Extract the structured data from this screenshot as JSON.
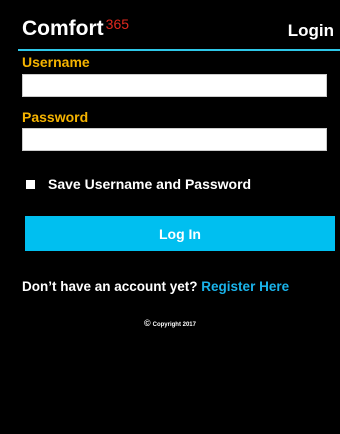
{
  "header": {
    "logo_word": "Comfort",
    "logo_super": "365",
    "title": "Login",
    "accent_color": "#2ec7e8",
    "logo_super_color": "#e0281e"
  },
  "form": {
    "username_label": "Username",
    "username_value": "",
    "password_label": "Password",
    "password_value": "",
    "remember_label": "Save Username and Password",
    "remember_checked": false,
    "submit_label": "Log In",
    "label_color": "#f6b400",
    "button_color": "#00bff0"
  },
  "signup": {
    "prompt": "Don’t have an account yet?",
    "link_label": "Register Here",
    "link_color": "#1ab3ea"
  },
  "footer": {
    "copyright_symbol": "©",
    "copyright_text": "Copyright 2017"
  }
}
